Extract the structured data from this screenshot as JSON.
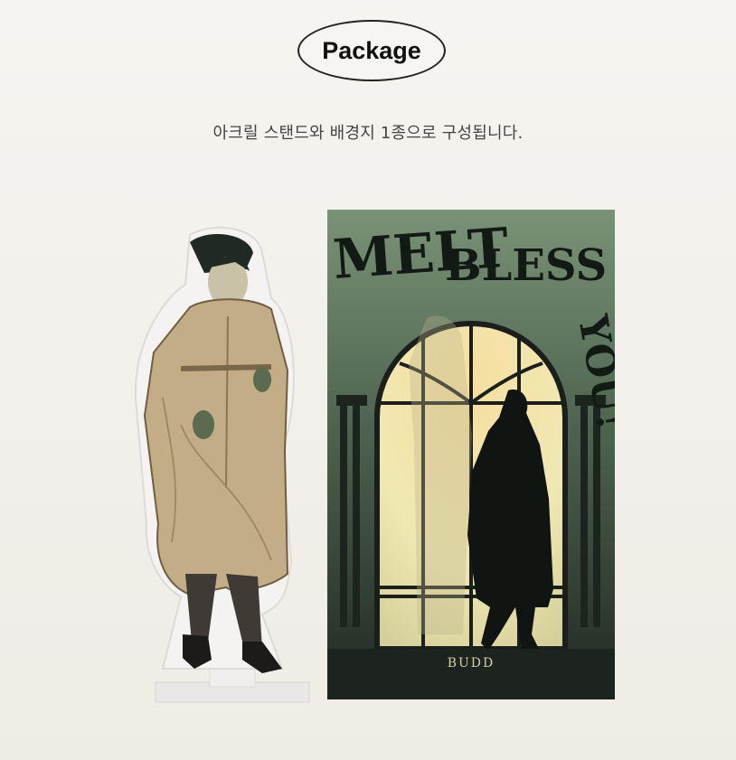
{
  "header": {
    "badge_label": "Package"
  },
  "description": "아크릴 스탠드와 배경지 1종으로 구성됩니다.",
  "background_card": {
    "title_text": "MELT BLESS YOU!",
    "brand": "BUDD",
    "colors": {
      "top": "#7a9276",
      "bottom": "#202822",
      "window": "#f0e8b2"
    }
  },
  "acrylic_stand": {
    "coat_color": "#c2ad86"
  }
}
